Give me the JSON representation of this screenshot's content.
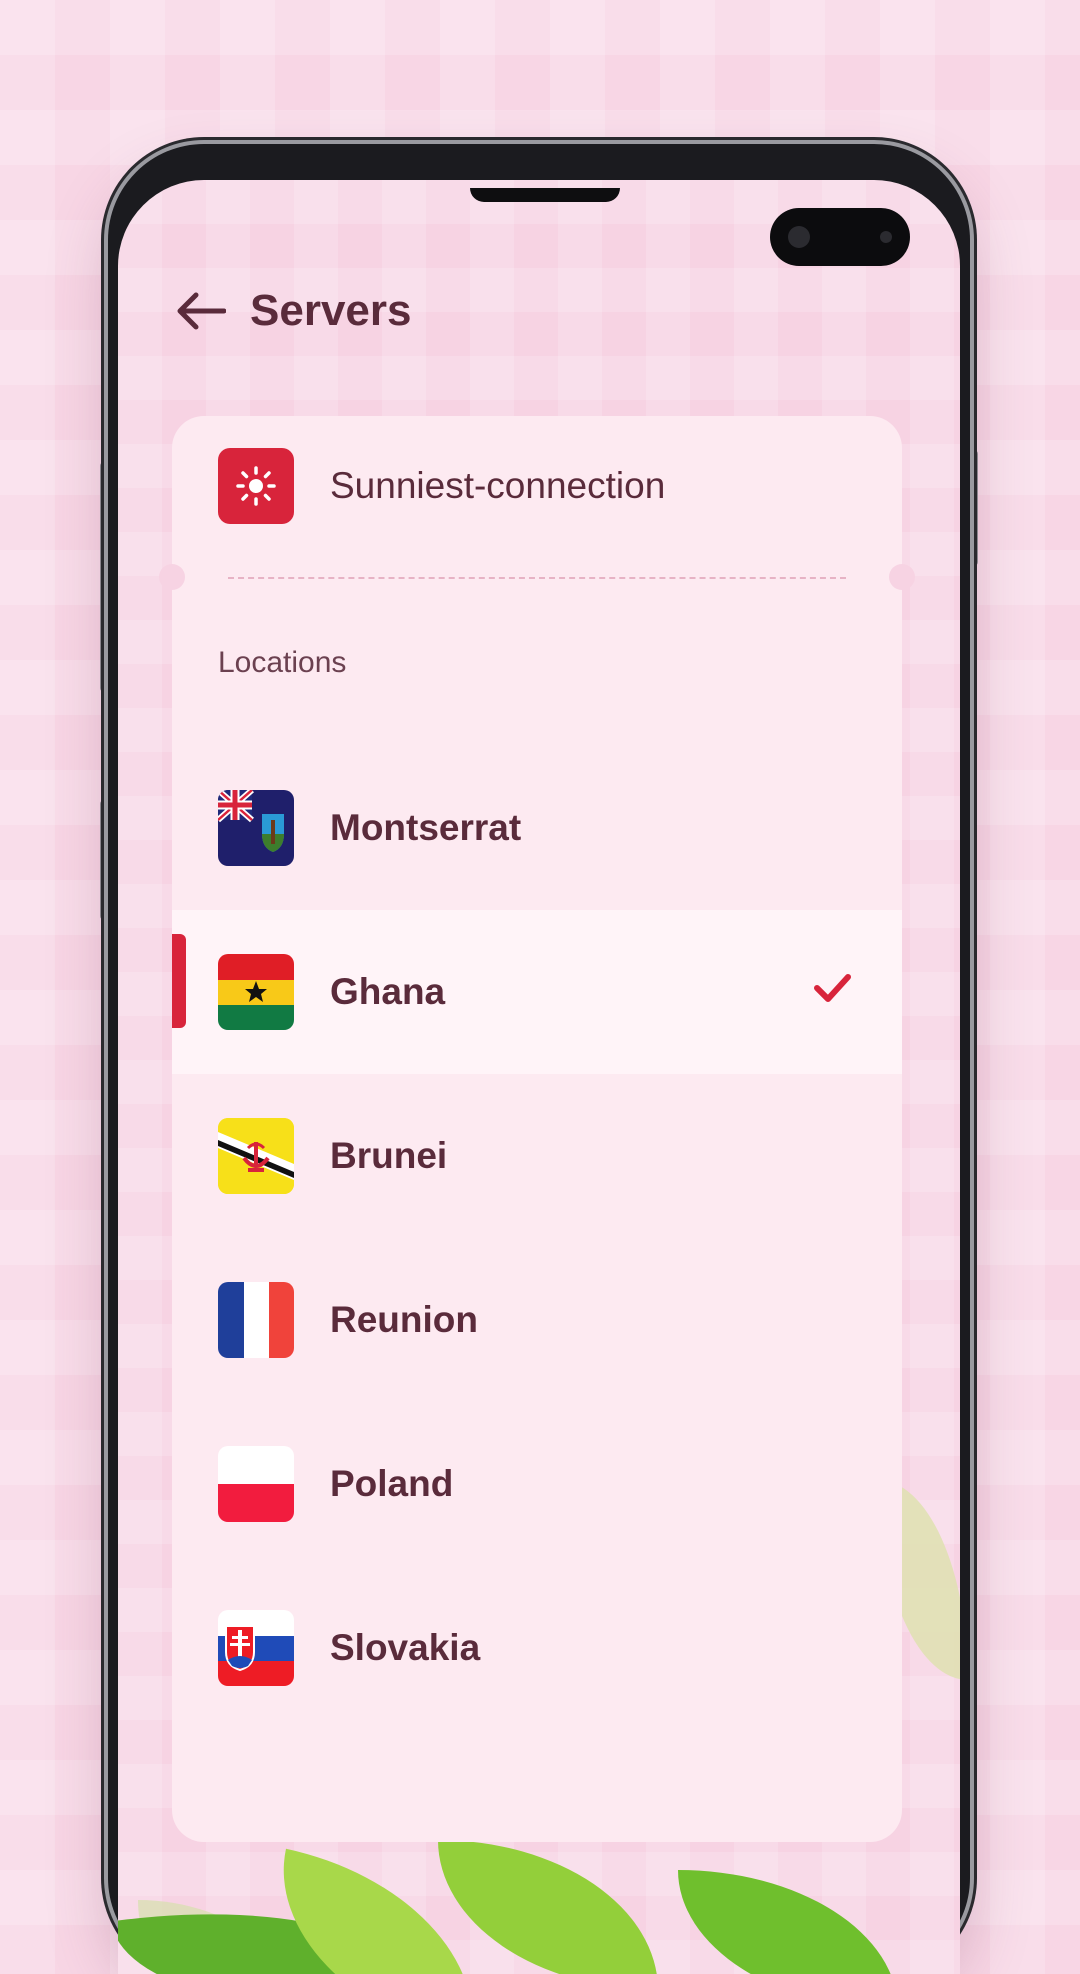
{
  "header": {
    "title": "Servers"
  },
  "sunniest": {
    "label": "Sunniest-connection"
  },
  "locations": {
    "heading": "Locations",
    "items": [
      {
        "name": "Montserrat",
        "flag": "montserrat-flag",
        "selected": false
      },
      {
        "name": "Ghana",
        "flag": "ghana-flag",
        "selected": true
      },
      {
        "name": "Brunei",
        "flag": "brunei-flag",
        "selected": false
      },
      {
        "name": "Reunion",
        "flag": "reunion-flag",
        "selected": false
      },
      {
        "name": "Poland",
        "flag": "poland-flag",
        "selected": false
      },
      {
        "name": "Slovakia",
        "flag": "slovakia-flag",
        "selected": false
      }
    ]
  },
  "colors": {
    "accent": "#d8243b",
    "text": "#5a2b3b",
    "card": "#fdeaf1",
    "background": "#f7d3e3"
  }
}
